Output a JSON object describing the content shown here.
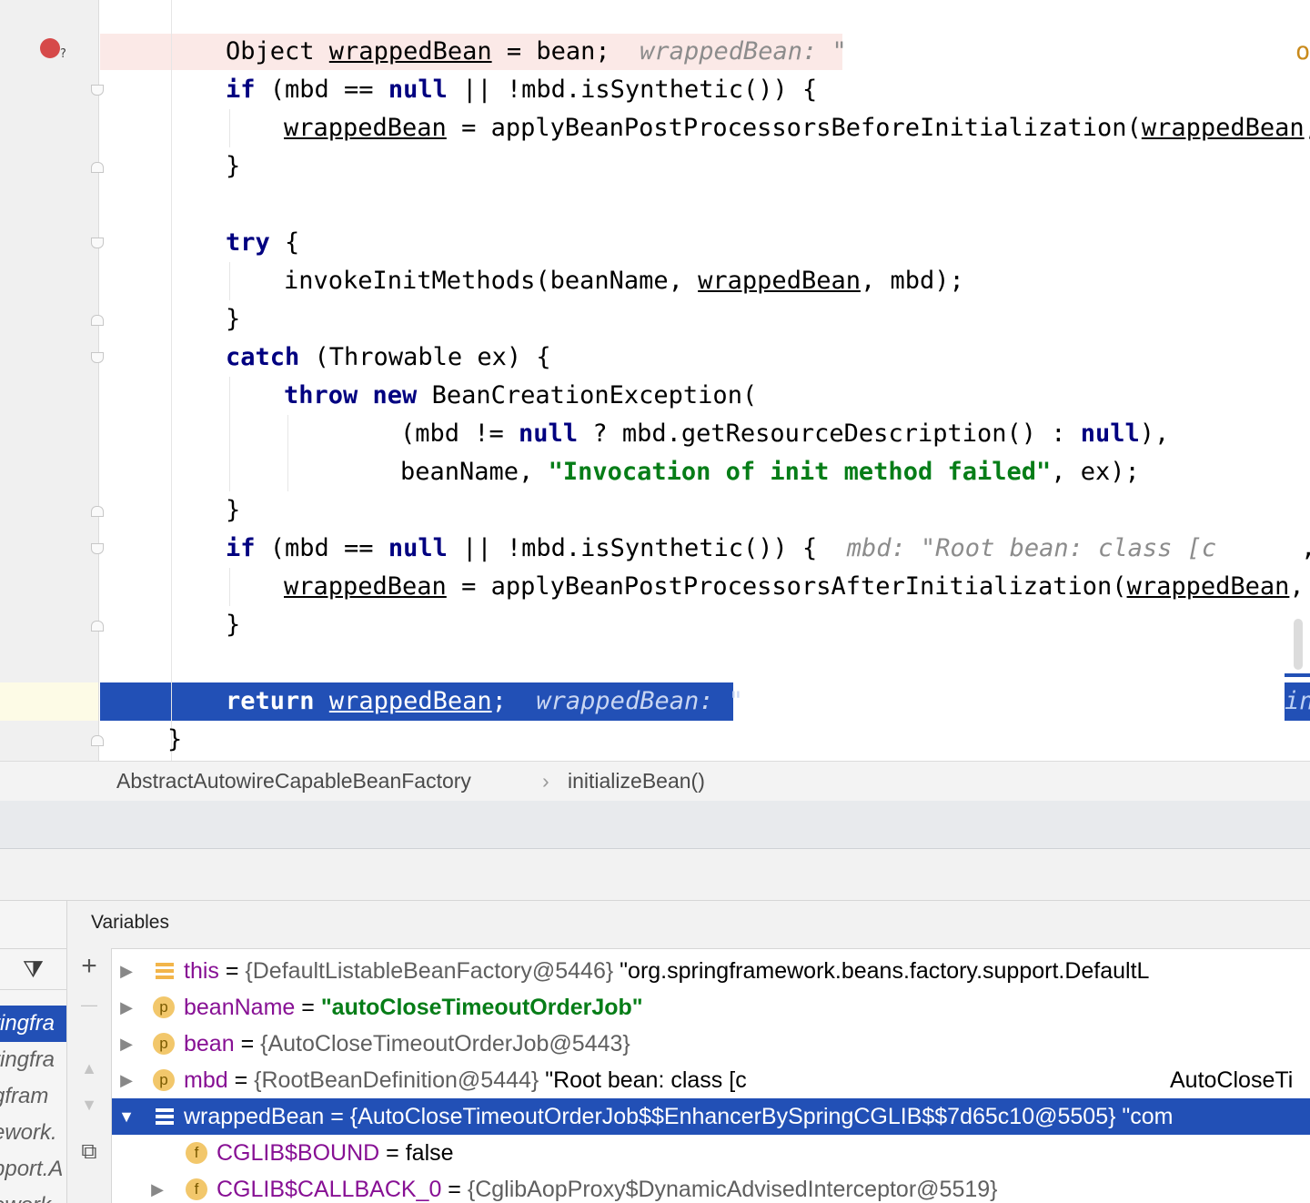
{
  "editor": {
    "lines": {
      "l1": {
        "a": "Object ",
        "b": "wrappedBean",
        "c": " = bean;  ",
        "hint": "wrappedBean: \"",
        "right": "o("
      },
      "l2": {
        "kw1": "if",
        "a": " (mbd == ",
        "kw2": "null",
        "b": " || !mbd.isSynthetic()) {"
      },
      "l3": {
        "a": "wrappedBean",
        "b": " = applyBeanPostProcessorsBeforeInitialization(",
        "c": "wrappedBean",
        "d": ","
      },
      "l4": {
        "a": "}"
      },
      "l6": {
        "kw": "try",
        "a": " {"
      },
      "l7": {
        "a": "invokeInitMethods(beanName, ",
        "b": "wrappedBean",
        "c": ", mbd);"
      },
      "l8": {
        "a": "}"
      },
      "l9": {
        "kw": "catch",
        "a": " (Throwable ex) {"
      },
      "l10": {
        "kw1": "throw",
        "sp": " ",
        "kw2": "new",
        "a": " BeanCreationException("
      },
      "l11": {
        "a": "(mbd != ",
        "kw1": "null",
        "b": " ? mbd.getResourceDescription() : ",
        "kw2": "null",
        "c": "),"
      },
      "l12": {
        "a": "beanName, ",
        "str": "\"Invocation of init method failed\"",
        "b": ", ex);"
      },
      "l13": {
        "a": "}"
      },
      "l14": {
        "kw1": "if",
        "a": " (mbd == ",
        "kw2": "null",
        "b": " || !mbd.isSynthetic()) {  ",
        "hint": "mbd: \"Root bean: class [c",
        "tail": ","
      },
      "l15": {
        "a": "wrappedBean",
        "b": " = applyBeanPostProcessorsAfterInitialization(",
        "c": "wrappedBean",
        "d": ", b"
      },
      "l16": {
        "a": "}"
      },
      "l18": {
        "kw": "return",
        "sp": " ",
        "a": "wrappedBean",
        "b": ";  ",
        "hint": "wrappedBean: \"",
        "right": "in"
      },
      "l19": {
        "a": "}"
      }
    }
  },
  "breadcrumb": {
    "class_name": "AbstractAutowireCapableBeanFactory",
    "separator": "›",
    "method": "initializeBean()"
  },
  "debugger": {
    "variables_title": "Variables",
    "frames": [
      "ringfra",
      "ringfra",
      "gfram",
      "ework.",
      "pport.A",
      "ework"
    ],
    "toolbar": {
      "filter": "⧩",
      "add": "+",
      "remove": "—",
      "up": "▲",
      "down": "▼",
      "copy": "⧉"
    },
    "rows": [
      {
        "arrow": "▶",
        "icon": "lines",
        "name": "this",
        "eq": " = ",
        "type": "{DefaultListableBeanFactory@5446}",
        "value": " \"org.springframework.beans.factory.support.DefaultL"
      },
      {
        "arrow": "▶",
        "icon": "p",
        "name": "beanName",
        "eq": " = ",
        "str": "\"autoCloseTimeoutOrderJob\""
      },
      {
        "arrow": "▶",
        "icon": "p",
        "name": "bean",
        "eq": " = ",
        "type": "{AutoCloseTimeoutOrderJob@5443}"
      },
      {
        "arrow": "▶",
        "icon": "p",
        "name": "mbd",
        "eq": " = ",
        "type": "{RootBeanDefinition@5444}",
        "value": " \"Root bean: class [c",
        "tail": "AutoCloseTi"
      },
      {
        "arrow": "▼",
        "icon": "lines",
        "name": "wrappedBean",
        "eq": " = ",
        "type": "{AutoCloseTimeoutOrderJob$$EnhancerBySpringCGLIB$$7d65c10@5505}",
        "value": " \"com"
      },
      {
        "arrow": "",
        "icon": "f",
        "name": "CGLIB$BOUND",
        "eq": " = ",
        "value": "false"
      },
      {
        "arrow": "▶",
        "icon": "f",
        "name": "CGLIB$CALLBACK_0",
        "eq": " = ",
        "type": "{CglibAopProxy$DynamicAdvisedInterceptor@5519}"
      }
    ]
  }
}
